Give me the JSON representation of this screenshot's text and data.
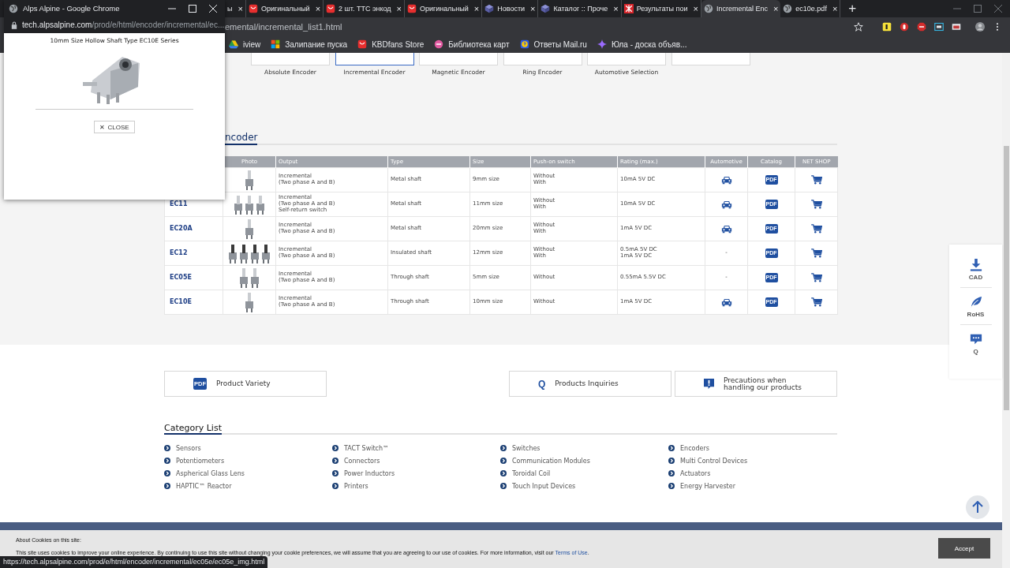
{
  "popup": {
    "title": "Alps Alpine - Google Chrome",
    "url_host": "tech.alpsalpine.com",
    "url_path": "/prod/e/html/encoder/incremental/ec...",
    "heading": "10mm Size Hollow Shaft Type EC10E Series",
    "close_icon": "✕",
    "close_label": "CLOSE"
  },
  "tabs": [
    {
      "label": "ы",
      "kind": "none",
      "selected": false
    },
    {
      "label": "Оригинальный",
      "kind": "shop",
      "selected": false
    },
    {
      "label": "2 шт. TTC энкод",
      "kind": "shop",
      "selected": false
    },
    {
      "label": "Оригинальный",
      "kind": "shop",
      "selected": false
    },
    {
      "label": "Новости",
      "kind": "cube",
      "selected": false
    },
    {
      "label": "Каталог :: Проче",
      "kind": "cube",
      "selected": false
    },
    {
      "label": "Результаты пои",
      "kind": "logo",
      "selected": false
    },
    {
      "label": "Incremental Enc",
      "kind": "globe",
      "selected": true
    },
    {
      "label": "ec10e.pdf",
      "kind": "globe",
      "selected": false
    }
  ],
  "tab_close": "×",
  "new_tab": "+",
  "address": {
    "url": "emental/incremental_list1.html"
  },
  "bookmarks": [
    {
      "label": "iview",
      "kind": "drive"
    },
    {
      "label": "Залипание пуска",
      "kind": "windows"
    },
    {
      "label": "KBDfans Store",
      "kind": "shop"
    },
    {
      "label": "Библиотека карт",
      "kind": "dot"
    },
    {
      "label": "Ответы Mail.ru",
      "kind": "question"
    },
    {
      "label": "Юла - доска объяв...",
      "kind": "star"
    }
  ],
  "category_tiles": [
    {
      "label": "Absolute Encoder",
      "selected": false
    },
    {
      "label": "Incremental Encoder",
      "selected": true
    },
    {
      "label": "Magnetic Encoder",
      "selected": false
    },
    {
      "label": "Ring Encoder",
      "selected": false
    },
    {
      "label": "Automotive Selection",
      "selected": false
    },
    {
      "selected": false
    }
  ],
  "section_title": "ncoder",
  "table": {
    "columns": [
      "Photo",
      "Output",
      "Type",
      "Size",
      "Push-on switch",
      "Rating (max.)",
      "Automotive",
      "Catalog",
      "NET SHOP"
    ],
    "rows": [
      {
        "output": "Incremental\n(Two phase A and B)",
        "type": "Metal shaft",
        "size": "9mm size",
        "push_on": "Without\nWith",
        "rating": "10mA 5V DC",
        "automotive": {
          "kind": "car"
        },
        "catalog": "PDF"
      },
      {
        "series": "EC11",
        "output": "Incremental\n(Two phase A and B)\nSelf-return switch",
        "type": "Metal shaft",
        "size": "11mm size",
        "push_on": "Without\nWith",
        "rating": "10mA 5V DC",
        "automotive": {
          "kind": "car"
        },
        "catalog": "PDF"
      },
      {
        "series": "EC20A",
        "output": "Incremental\n(Two phase A and B)",
        "type": "Metal shaft",
        "size": "20mm size",
        "push_on": "Without\nWith",
        "rating": "1mA 5V DC",
        "automotive": {
          "kind": "car"
        },
        "catalog": "PDF"
      },
      {
        "series": "EC12",
        "output": "Incremental\n(Two phase A and B)",
        "type": "Insulated shaft",
        "size": "12mm size",
        "push_on": "Without\nWith",
        "rating": "0.5mA 5V DC\n1mA 5V DC",
        "automotive": {
          "kind": "dash",
          "text": "-"
        },
        "catalog": "PDF"
      },
      {
        "series": "EC05E",
        "output": "Incremental\n(Two phase A and B)",
        "type": "Through shaft",
        "size": "5mm size",
        "push_on": "Without",
        "rating": "0.55mA 5.5V DC",
        "automotive": {
          "kind": "dash",
          "text": "-"
        },
        "catalog": "PDF"
      },
      {
        "series": "EC10E",
        "output": "Incremental\n(Two phase A and B)",
        "type": "Through shaft",
        "size": "10mm size",
        "push_on": "Without",
        "rating": "1mA 5V DC",
        "automotive": {
          "kind": "car"
        },
        "catalog": "PDF"
      }
    ]
  },
  "link_buttons": [
    {
      "label": "Product Variety",
      "kind": "pdf",
      "icon_text": "PDF"
    },
    {
      "label": "Products Inquiries",
      "kind": "q",
      "icon_text": "Q"
    },
    {
      "label": "Precautions when\nhandling our products",
      "kind": "alert"
    }
  ],
  "category_list": {
    "title": "Category List",
    "columns": [
      [
        "Sensors",
        "Potentiometers",
        "Aspherical Glass Lens",
        "HAPTIC™ Reactor"
      ],
      [
        "TACT Switch™",
        "Connectors",
        "Power Inductors",
        "Printers"
      ],
      [
        "Switches",
        "Communication Modules",
        "Toroidal Coil",
        "Touch Input Devices"
      ],
      [
        "Encoders",
        "Multi Control Devices",
        "Actuators",
        "Energy Harvester"
      ]
    ]
  },
  "side_panel": [
    {
      "label": "CAD",
      "kind": "download"
    },
    {
      "label": "RoHS",
      "kind": "leaf"
    },
    {
      "label": "Q",
      "kind": "chat"
    }
  ],
  "cookie": {
    "title": "About Cookies on this site:",
    "text": "This site uses cookies to improve your online experience. By continuing to use this site without changing your cookie preferences, we will assume that you are agreeing to our use of cookies. For more information, visit our",
    "link": "Terms of Use",
    "end": ".",
    "accept": "Accept"
  },
  "status_url": "https://tech.alpsalpine.com/prod/e/html/encoder/incremental/ec05e/ec05e_img.html"
}
